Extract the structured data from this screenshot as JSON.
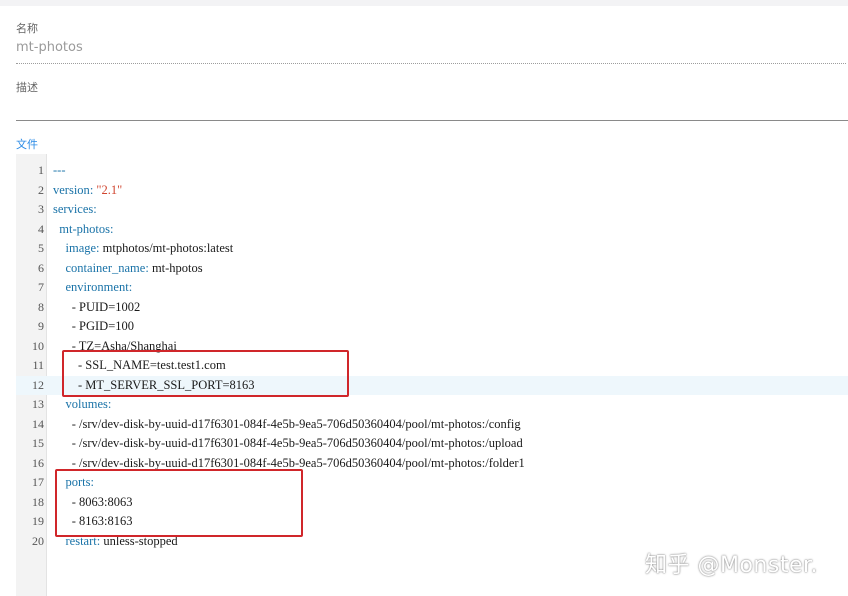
{
  "form": {
    "name_label": "名称",
    "name_value": "mt-photos",
    "description_label": "描述",
    "description_value": "",
    "file_label": "文件"
  },
  "editor": {
    "lines": [
      {
        "num": "1",
        "indent": "",
        "key": "---",
        "sep": "",
        "value": "",
        "value_type": "plain",
        "comment": true
      },
      {
        "num": "2",
        "indent": "",
        "key": "version",
        "sep": ": ",
        "value": "\"2.1\"",
        "value_type": "string"
      },
      {
        "num": "3",
        "indent": "",
        "key": "services",
        "sep": ":",
        "value": "",
        "value_type": "plain"
      },
      {
        "num": "4",
        "indent": "  ",
        "key": "mt-photos",
        "sep": ":",
        "value": "",
        "value_type": "plain"
      },
      {
        "num": "5",
        "indent": "    ",
        "key": "image",
        "sep": ": ",
        "value": "mtphotos/mt-photos:latest",
        "value_type": "plain"
      },
      {
        "num": "6",
        "indent": "    ",
        "key": "container_name",
        "sep": ": ",
        "value": "mt-hpotos",
        "value_type": "plain"
      },
      {
        "num": "7",
        "indent": "    ",
        "key": "environment",
        "sep": ":",
        "value": "",
        "value_type": "plain"
      },
      {
        "num": "8",
        "indent": "      ",
        "key": "",
        "sep": "",
        "value": "- PUID=1002",
        "value_type": "plain"
      },
      {
        "num": "9",
        "indent": "      ",
        "key": "",
        "sep": "",
        "value": "- PGID=100",
        "value_type": "plain"
      },
      {
        "num": "10",
        "indent": "      ",
        "key": "",
        "sep": "",
        "value": "- TZ=Asha/Shanghai",
        "value_type": "plain"
      },
      {
        "num": "11",
        "indent": "        ",
        "key": "",
        "sep": "",
        "value": "- SSL_NAME=test.test1.com",
        "value_type": "plain"
      },
      {
        "num": "12",
        "indent": "        ",
        "key": "",
        "sep": "",
        "value": "- MT_SERVER_SSL_PORT=8163",
        "value_type": "plain",
        "active": true
      },
      {
        "num": "13",
        "indent": "    ",
        "key": "volumes",
        "sep": ":",
        "value": "",
        "value_type": "plain"
      },
      {
        "num": "14",
        "indent": "      ",
        "key": "",
        "sep": "",
        "value": "- /srv/dev-disk-by-uuid-d17f6301-084f-4e5b-9ea5-706d50360404/pool/mt-photos:/config",
        "value_type": "plain"
      },
      {
        "num": "15",
        "indent": "      ",
        "key": "",
        "sep": "",
        "value": "- /srv/dev-disk-by-uuid-d17f6301-084f-4e5b-9ea5-706d50360404/pool/mt-photos:/upload",
        "value_type": "plain"
      },
      {
        "num": "16",
        "indent": "      ",
        "key": "",
        "sep": "",
        "value": "- /srv/dev-disk-by-uuid-d17f6301-084f-4e5b-9ea5-706d50360404/pool/mt-photos:/folder1",
        "value_type": "plain"
      },
      {
        "num": "17",
        "indent": "    ",
        "key": "ports",
        "sep": ":",
        "value": "",
        "value_type": "plain"
      },
      {
        "num": "18",
        "indent": "      ",
        "key": "",
        "sep": "",
        "value": "- 8063:8063",
        "value_type": "plain"
      },
      {
        "num": "19",
        "indent": "      ",
        "key": "",
        "sep": "",
        "value": "- 8163:8163",
        "value_type": "plain"
      },
      {
        "num": "20",
        "indent": "    ",
        "key": "restart",
        "sep": ": ",
        "value": "unless-stopped",
        "value_type": "plain"
      }
    ]
  },
  "annotations": {
    "box_color": "#d0262a"
  },
  "watermark": {
    "text": "知乎 @Monster."
  },
  "colors": {
    "key": "#1a73a8",
    "string": "#d0452f",
    "link_label": "#2b8be6"
  }
}
